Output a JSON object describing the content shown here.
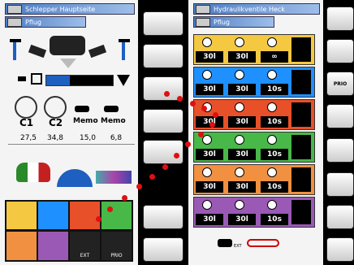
{
  "left": {
    "title": "Schlepper Hauptseite",
    "subtitle": "Pflug",
    "memo1": "Memo",
    "memo2": "Memo",
    "c1": "C1",
    "c2": "C2",
    "values": [
      "27,5",
      "34,8",
      "15,0",
      "6,8"
    ],
    "exts": [
      "EXT",
      "PRIO"
    ]
  },
  "right": {
    "title": "Hydraulikventile Heck",
    "subtitle": "Pflug",
    "rows": [
      {
        "color": "#f5c842",
        "cells": [
          "30l",
          "30l",
          "∞"
        ]
      },
      {
        "color": "#1e90ff",
        "cells": [
          "30l",
          "30l",
          "10s"
        ]
      },
      {
        "color": "#e8502a",
        "cells": [
          "30l",
          "30l",
          "10s"
        ]
      },
      {
        "color": "#48b848",
        "cells": [
          "30l",
          "30l",
          "10s"
        ]
      },
      {
        "color": "#f09040",
        "cells": [
          "30l",
          "30l",
          "10s"
        ]
      },
      {
        "color": "#9b59b6",
        "cells": [
          "30l",
          "30l",
          "10s"
        ]
      }
    ],
    "ext": "EXT",
    "prio": "PRIO"
  }
}
